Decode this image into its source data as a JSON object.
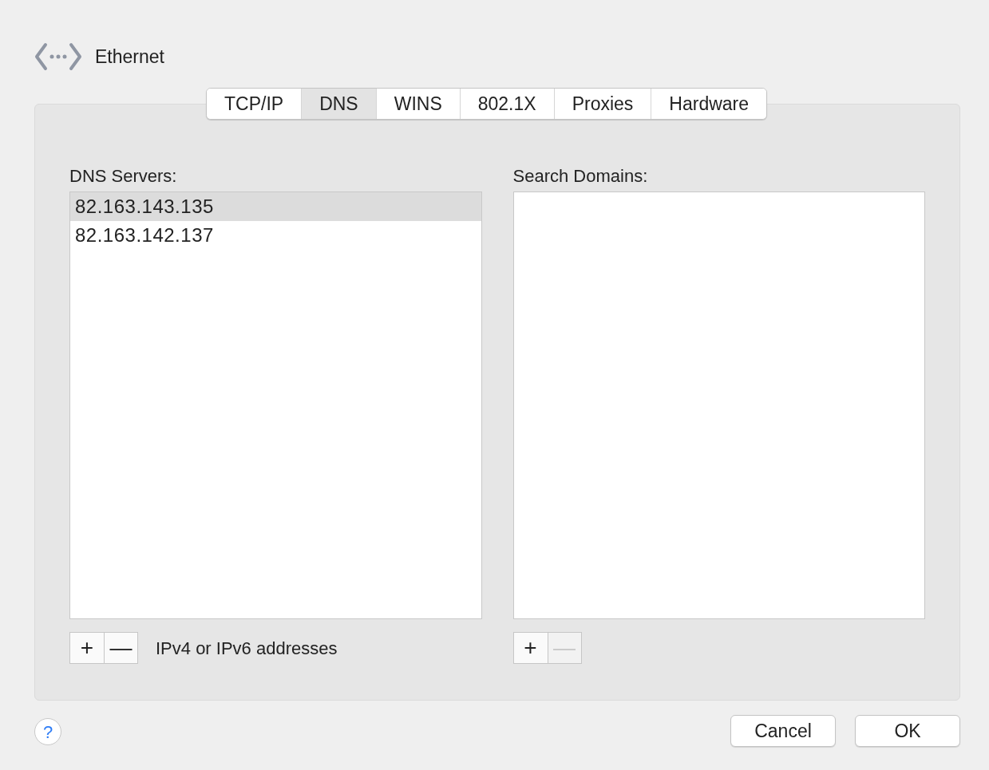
{
  "header": {
    "title": "Ethernet"
  },
  "tabs": [
    {
      "label": "TCP/IP",
      "selected": false
    },
    {
      "label": "DNS",
      "selected": true
    },
    {
      "label": "WINS",
      "selected": false
    },
    {
      "label": "802.1X",
      "selected": false
    },
    {
      "label": "Proxies",
      "selected": false
    },
    {
      "label": "Hardware",
      "selected": false
    }
  ],
  "dns_servers": {
    "label": "DNS Servers:",
    "items": [
      {
        "text": "82.163.143.135",
        "selected": true
      },
      {
        "text": "82.163.142.137",
        "selected": false
      }
    ],
    "buttons": [
      {
        "label": "+",
        "disabled": false
      },
      {
        "label": "—",
        "disabled": false
      }
    ],
    "hint": "IPv4 or IPv6 addresses"
  },
  "search_domains": {
    "label": "Search Domains:",
    "buttons": [
      {
        "label": "+",
        "disabled": false
      },
      {
        "label": "—",
        "disabled": true
      }
    ]
  },
  "help": "?",
  "footer_buttons": [
    "Cancel",
    "OK"
  ]
}
